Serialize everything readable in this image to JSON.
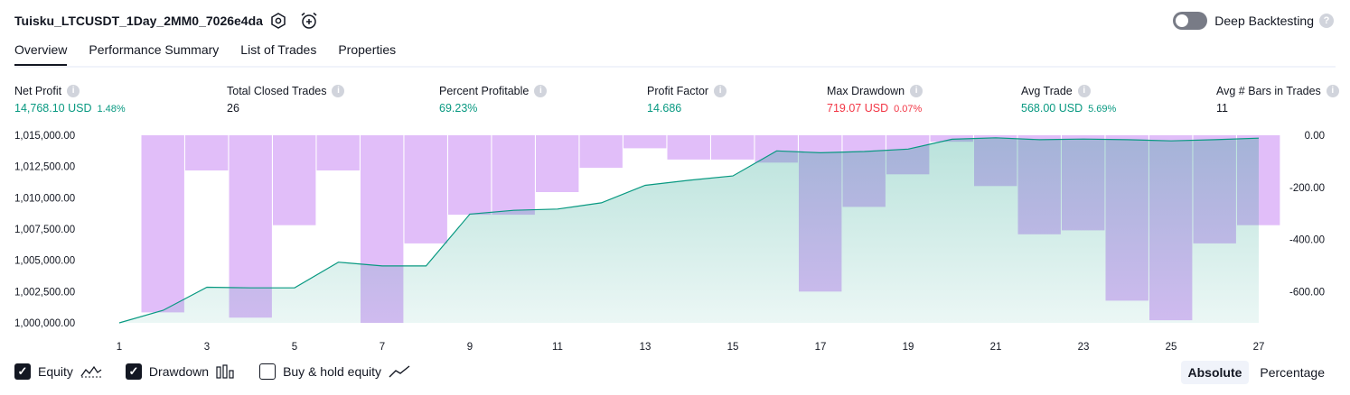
{
  "header": {
    "title": "Tuisku_LTCUSDT_1Day_2MM0_7026e4da",
    "settings_icon": "hexagon-gear-icon",
    "alert_icon": "alarm-clock-plus-icon",
    "deep_backtesting_label": "Deep Backtesting",
    "deep_backtesting_enabled": false,
    "help_icon": "question-icon"
  },
  "tabs": [
    {
      "label": "Overview",
      "active": true
    },
    {
      "label": "Performance Summary",
      "active": false
    },
    {
      "label": "List of Trades",
      "active": false
    },
    {
      "label": "Properties",
      "active": false
    }
  ],
  "metrics": [
    {
      "label": "Net Profit",
      "value": "14,768.10 USD",
      "sub": "1.48%",
      "color": "#089981"
    },
    {
      "label": "Total Closed Trades",
      "value": "26",
      "sub": "",
      "color": "#131722"
    },
    {
      "label": "Percent Profitable",
      "value": "69.23%",
      "sub": "",
      "color": "#089981"
    },
    {
      "label": "Profit Factor",
      "value": "14.686",
      "sub": "",
      "color": "#089981"
    },
    {
      "label": "Max Drawdown",
      "value": "719.07 USD",
      "sub": "0.07%",
      "color": "#f23645"
    },
    {
      "label": "Avg Trade",
      "value": "568.00 USD",
      "sub": "5.69%",
      "color": "#089981"
    },
    {
      "label": "Avg # Bars in Trades",
      "value": "11",
      "sub": "",
      "color": "#131722"
    }
  ],
  "chart_data": {
    "type": "area",
    "x": [
      1,
      2,
      3,
      4,
      5,
      6,
      7,
      8,
      9,
      10,
      11,
      12,
      13,
      14,
      15,
      16,
      17,
      18,
      19,
      20,
      21,
      22,
      23,
      24,
      25,
      26,
      27
    ],
    "x_tick_labels": [
      "1",
      "3",
      "5",
      "7",
      "9",
      "11",
      "13",
      "15",
      "17",
      "19",
      "21",
      "23",
      "25",
      "27"
    ],
    "left_axis": {
      "tick_labels": [
        "1,015,000.00",
        "1,012,500.00",
        "1,010,000.00",
        "1,007,500.00",
        "1,005,000.00",
        "1,002,500.00",
        "1,000,000.00"
      ],
      "ylim": [
        1000000,
        1015000
      ]
    },
    "right_axis": {
      "tick_labels": [
        "0.00",
        "-200.00",
        "-400.00",
        "-600.00"
      ],
      "ylim": [
        -720,
        0
      ]
    },
    "series": [
      {
        "name": "Equity",
        "type": "area",
        "axis": "left",
        "color": "#089981",
        "values": [
          1000000,
          1001000,
          1002850,
          1002800,
          1002800,
          1004850,
          1004550,
          1004550,
          1008700,
          1009000,
          1009100,
          1009600,
          1011000,
          1011400,
          1011750,
          1013750,
          1013600,
          1013700,
          1013900,
          1014680,
          1014800,
          1014650,
          1014700,
          1014650,
          1014550,
          1014650,
          1014770
        ]
      },
      {
        "name": "Drawdown",
        "type": "bar",
        "axis": "right",
        "color": "#c084fc",
        "values": [
          0,
          -680,
          -135,
          -700,
          -345,
          -135,
          -720,
          -415,
          -305,
          -305,
          -218,
          -125,
          -50,
          -93,
          -93,
          -105,
          -600,
          -275,
          -150,
          -25,
          -195,
          -380,
          -365,
          -635,
          -710,
          -415,
          -345
        ]
      }
    ]
  },
  "legend": [
    {
      "label": "Equity",
      "checked": true,
      "icon": "equity-line-icon"
    },
    {
      "label": "Drawdown",
      "checked": true,
      "icon": "drawdown-bars-icon"
    },
    {
      "label": "Buy & hold equity",
      "checked": false,
      "icon": "buy-hold-line-icon"
    }
  ],
  "modes": [
    {
      "label": "Absolute",
      "active": true
    },
    {
      "label": "Percentage",
      "active": false
    }
  ]
}
